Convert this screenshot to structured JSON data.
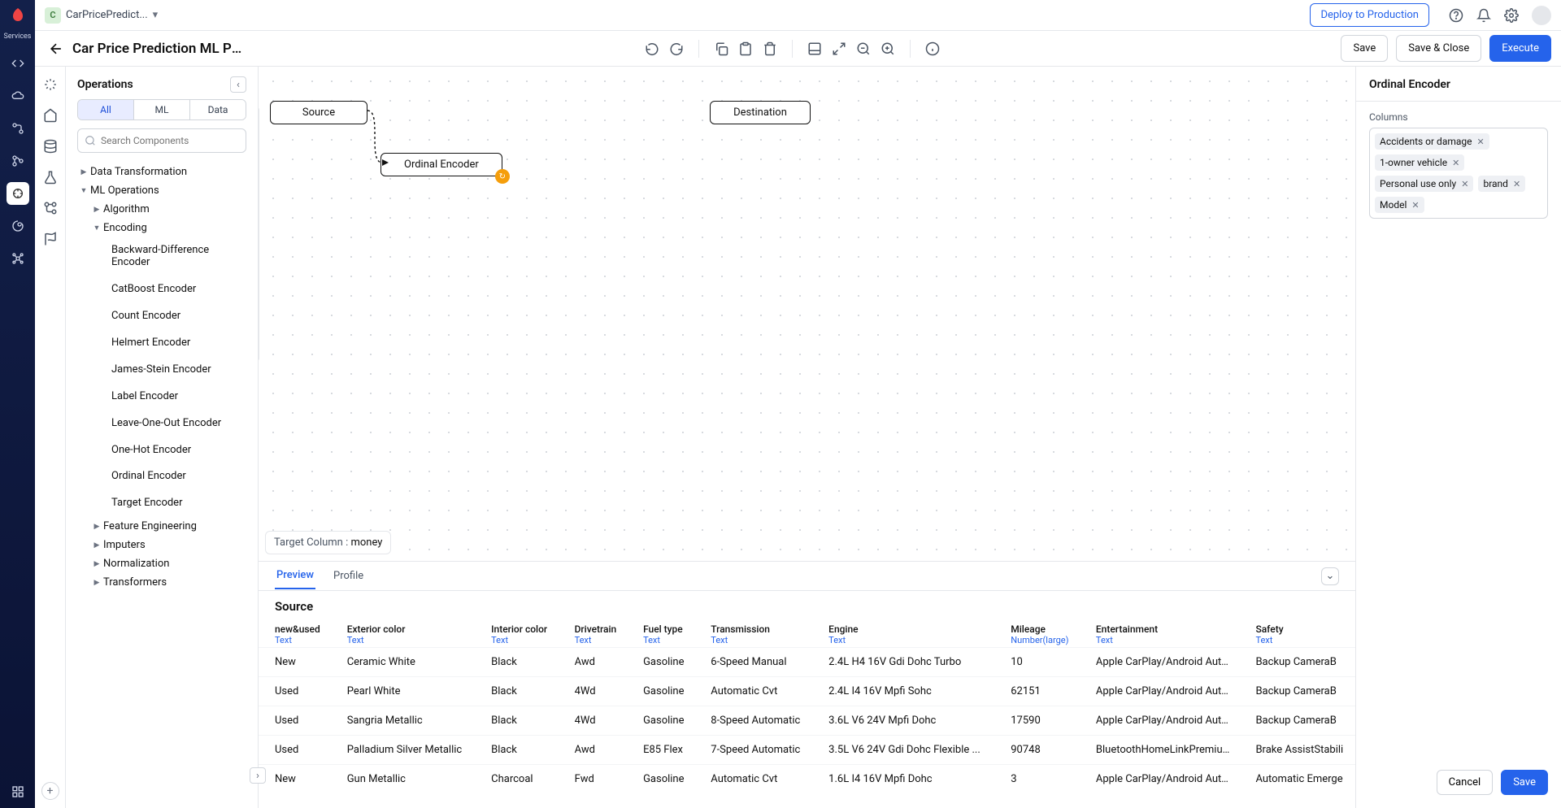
{
  "services_label": "Services",
  "project": {
    "initial": "C",
    "name": "CarPricePredict..."
  },
  "deploy_label": "Deploy to Production",
  "editor": {
    "title": "Car Price Prediction ML Pip...",
    "save": "Save",
    "save_close": "Save & Close",
    "execute": "Execute"
  },
  "ops": {
    "title": "Operations",
    "tabs": {
      "all": "All",
      "ml": "ML",
      "data": "Data"
    },
    "search_placeholder": "Search Components",
    "groups": {
      "dt": "Data Transformation",
      "mlops": "ML Operations",
      "algo": "Algorithm",
      "enc": "Encoding",
      "leaves": [
        "Backward-Difference Encoder",
        "CatBoost Encoder",
        "Count Encoder",
        "Helmert Encoder",
        "James-Stein Encoder",
        "Label Encoder",
        "Leave-One-Out Encoder",
        "One-Hot Encoder",
        "Ordinal Encoder",
        "Target Encoder"
      ],
      "fe": "Feature Engineering",
      "imp": "Imputers",
      "norm": "Normalization",
      "trf": "Transformers"
    }
  },
  "canvas": {
    "source": "Source",
    "destination": "Destination",
    "encoder": "Ordinal Encoder",
    "target_label": "Target Column :",
    "target_value": "money"
  },
  "bottom": {
    "tab_preview": "Preview",
    "tab_profile": "Profile",
    "source_title": "Source",
    "columns": [
      {
        "name": "new&used",
        "dtype": "Text"
      },
      {
        "name": "Exterior color",
        "dtype": "Text"
      },
      {
        "name": "Interior color",
        "dtype": "Text"
      },
      {
        "name": "Drivetrain",
        "dtype": "Text"
      },
      {
        "name": "Fuel type",
        "dtype": "Text"
      },
      {
        "name": "Transmission",
        "dtype": "Text"
      },
      {
        "name": "Engine",
        "dtype": "Text"
      },
      {
        "name": "Mileage",
        "dtype": "Number(large)"
      },
      {
        "name": "Entertainment",
        "dtype": "Text"
      },
      {
        "name": "Safety",
        "dtype": "Text"
      }
    ],
    "rows": [
      [
        "New",
        "Ceramic White",
        "Black",
        "Awd",
        "Gasoline",
        "6-Speed Manual",
        "2.4L H4 16V Gdi Dohc Turbo",
        "10",
        "Apple CarPlay/Android AutoBlu...",
        "Backup CameraB"
      ],
      [
        "Used",
        "Pearl White",
        "Black",
        "4Wd",
        "Gasoline",
        "Automatic Cvt",
        "2.4L I4 16V Mpfi Sohc",
        "62151",
        "Apple CarPlay/Android AutoBlu...",
        "Backup CameraB"
      ],
      [
        "Used",
        "Sangria Metallic",
        "Black",
        "4Wd",
        "Gasoline",
        "8-Speed Automatic",
        "3.6L V6 24V Mpfi Dohc",
        "17590",
        "Apple CarPlay/Android AutoBlu...",
        "Backup CameraB"
      ],
      [
        "Used",
        "Palladium Silver Metallic",
        "Black",
        "Awd",
        "E85 Flex",
        "7-Speed Automatic",
        "3.5L V6 24V Gdi Dohc Flexible ...",
        "90748",
        "BluetoothHomeLinkPremium S...",
        "Brake AssistStabili"
      ],
      [
        "New",
        "Gun Metallic",
        "Charcoal",
        "Fwd",
        "Gasoline",
        "Automatic Cvt",
        "1.6L I4 16V Mpfi Dohc",
        "3",
        "Apple CarPlay/Android AutoBlu...",
        "Automatic Emerge"
      ]
    ]
  },
  "panel": {
    "title": "Ordinal Encoder",
    "columns_label": "Columns",
    "tags": [
      "Accidents or damage",
      "1-owner vehicle",
      "Personal use only",
      "brand",
      "Model"
    ],
    "cancel": "Cancel",
    "save": "Save"
  }
}
